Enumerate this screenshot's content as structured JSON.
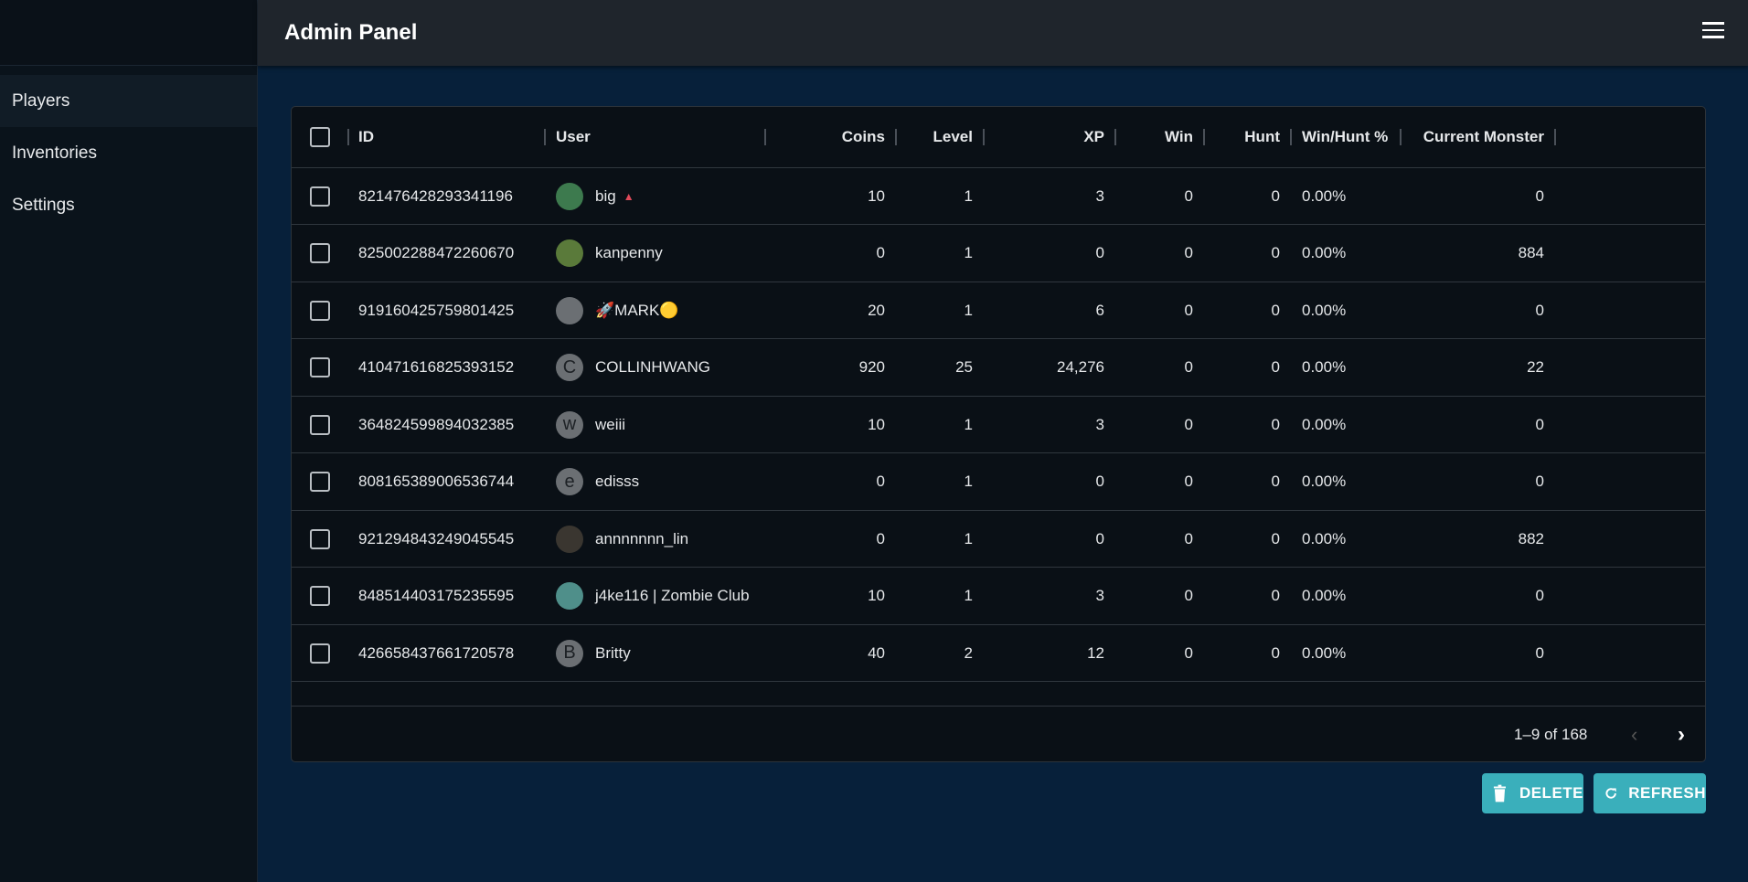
{
  "header": {
    "title": "Admin Panel",
    "menu_icon": "hamburger-icon"
  },
  "sidebar": {
    "items": [
      {
        "label": "Players",
        "active": true
      },
      {
        "label": "Inventories"
      },
      {
        "label": "Settings"
      }
    ]
  },
  "table": {
    "columns": [
      "ID",
      "User",
      "Coins",
      "Level",
      "XP",
      "Win",
      "Hunt",
      "Win/Hunt %",
      "Current Monster"
    ],
    "rows": [
      {
        "id": "821476428293341196",
        "user": "big",
        "suffix": "▲",
        "avatar": "",
        "avatar_color": "#3d7a4e",
        "coins": "10",
        "level": "1",
        "xp": "3",
        "win": "0",
        "hunt": "0",
        "ratio": "0.00%",
        "monster": "0"
      },
      {
        "id": "825002288472260670",
        "user": "kanpenny",
        "avatar": "",
        "avatar_color": "#5a7a3a",
        "coins": "0",
        "level": "1",
        "xp": "0",
        "win": "0",
        "hunt": "0",
        "ratio": "0.00%",
        "monster": "884"
      },
      {
        "id": "919160425759801425",
        "user": "🚀MARK🟡",
        "avatar": "",
        "avatar_color": "#6b6f73",
        "coins": "20",
        "level": "1",
        "xp": "6",
        "win": "0",
        "hunt": "0",
        "ratio": "0.00%",
        "monster": "0"
      },
      {
        "id": "410471616825393152",
        "user": "COLLINHWANG",
        "avatar": "C",
        "avatar_color": "#6b6f73",
        "coins": "920",
        "level": "25",
        "xp": "24,276",
        "win": "0",
        "hunt": "0",
        "ratio": "0.00%",
        "monster": "22"
      },
      {
        "id": "364824599894032385",
        "user": "weiii",
        "avatar": "w",
        "avatar_color": "#6b6f73",
        "coins": "10",
        "level": "1",
        "xp": "3",
        "win": "0",
        "hunt": "0",
        "ratio": "0.00%",
        "monster": "0"
      },
      {
        "id": "808165389006536744",
        "user": "edisss",
        "avatar": "e",
        "avatar_color": "#6b6f73",
        "coins": "0",
        "level": "1",
        "xp": "0",
        "win": "0",
        "hunt": "0",
        "ratio": "0.00%",
        "monster": "0"
      },
      {
        "id": "921294843249045545",
        "user": "annnnnnn_lin",
        "avatar": "",
        "avatar_color": "#3a3630",
        "coins": "0",
        "level": "1",
        "xp": "0",
        "win": "0",
        "hunt": "0",
        "ratio": "0.00%",
        "monster": "882"
      },
      {
        "id": "848514403175235595",
        "user": "j4ke116 | Zombie Club",
        "avatar": "",
        "avatar_color": "#4f8f8a",
        "coins": "10",
        "level": "1",
        "xp": "3",
        "win": "0",
        "hunt": "0",
        "ratio": "0.00%",
        "monster": "0"
      },
      {
        "id": "426658437661720578",
        "user": "Britty",
        "avatar": "B",
        "avatar_color": "#6b6f73",
        "coins": "40",
        "level": "2",
        "xp": "12",
        "win": "0",
        "hunt": "0",
        "ratio": "0.00%",
        "monster": "0"
      }
    ]
  },
  "pagination": {
    "label": "1–9 of 168"
  },
  "actions": {
    "delete": "DELETE",
    "refresh": "REFRESH"
  },
  "colors": {
    "accent": "#3aafbb",
    "background": "#07203a",
    "table": "#0a1016"
  }
}
